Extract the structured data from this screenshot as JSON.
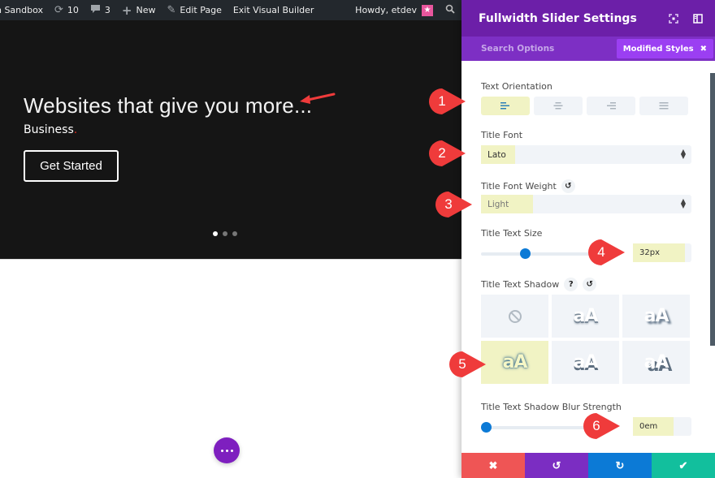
{
  "adminbar": {
    "site_name": "gn Sandbox",
    "updates_count": "10",
    "comments_count": "3",
    "new_label": "New",
    "edit_page_label": "Edit Page",
    "exit_builder_label": "Exit Visual Builder",
    "greeting": "Howdy, etdev",
    "avatar_glyph": "★",
    "icons": {
      "updates": "refresh-icon",
      "comments": "comment-icon",
      "new": "plus-icon",
      "edit": "pencil-icon",
      "search": "search-icon"
    }
  },
  "slider": {
    "title": "Websites that give you more...",
    "subtitle": "Business",
    "subtitle_dot": ".",
    "button_label": "Get Started",
    "slide_count": 3,
    "active_slide": 1
  },
  "fab": {
    "icon": "more-dots-icon"
  },
  "panel": {
    "title": "Fullwidth Slider Settings",
    "search_placeholder": "Search Options",
    "modified_chip_label": "Modified Styles",
    "modified_chip_close": "✖",
    "fields": {
      "text_orientation": {
        "label": "Text Orientation",
        "options": [
          "left",
          "center",
          "right",
          "justify"
        ],
        "selected": "left"
      },
      "title_font": {
        "label": "Title Font",
        "value": "Lato"
      },
      "title_font_weight": {
        "label": "Title Font Weight",
        "value": "Light"
      },
      "title_text_size": {
        "label": "Title Text Size",
        "value": "32px",
        "slider_fraction": 0.34
      },
      "title_text_shadow": {
        "label": "Title Text Shadow",
        "help_glyph": "?",
        "options": [
          "none",
          "shadow-1",
          "shadow-2",
          "shadow-3",
          "shadow-4",
          "shadow-5"
        ],
        "selected": "shadow-3",
        "preview_text": "aA"
      },
      "title_text_shadow_blur": {
        "label": "Title Text Shadow Blur Strength",
        "value": "0em",
        "slider_fraction": 0.0
      }
    },
    "footer": {
      "cancel_glyph": "✖",
      "undo_glyph": "↺",
      "redo_glyph": "↻",
      "save_glyph": "✔"
    }
  },
  "annotations": {
    "markers": [
      "1",
      "2",
      "3",
      "4",
      "5",
      "6"
    ],
    "color": "#ef3b3b",
    "highlight_color": "#f1f3c4"
  },
  "colors": {
    "panel_header": "#6c1fa8",
    "panel_tabs": "#7d2fc4",
    "chip": "#9b3ff2",
    "accent_blue": "#0c7ad6",
    "cancel": "#ef5555",
    "undo": "#7b2dc2",
    "redo": "#0c7ad6",
    "save": "#12bf9d"
  }
}
